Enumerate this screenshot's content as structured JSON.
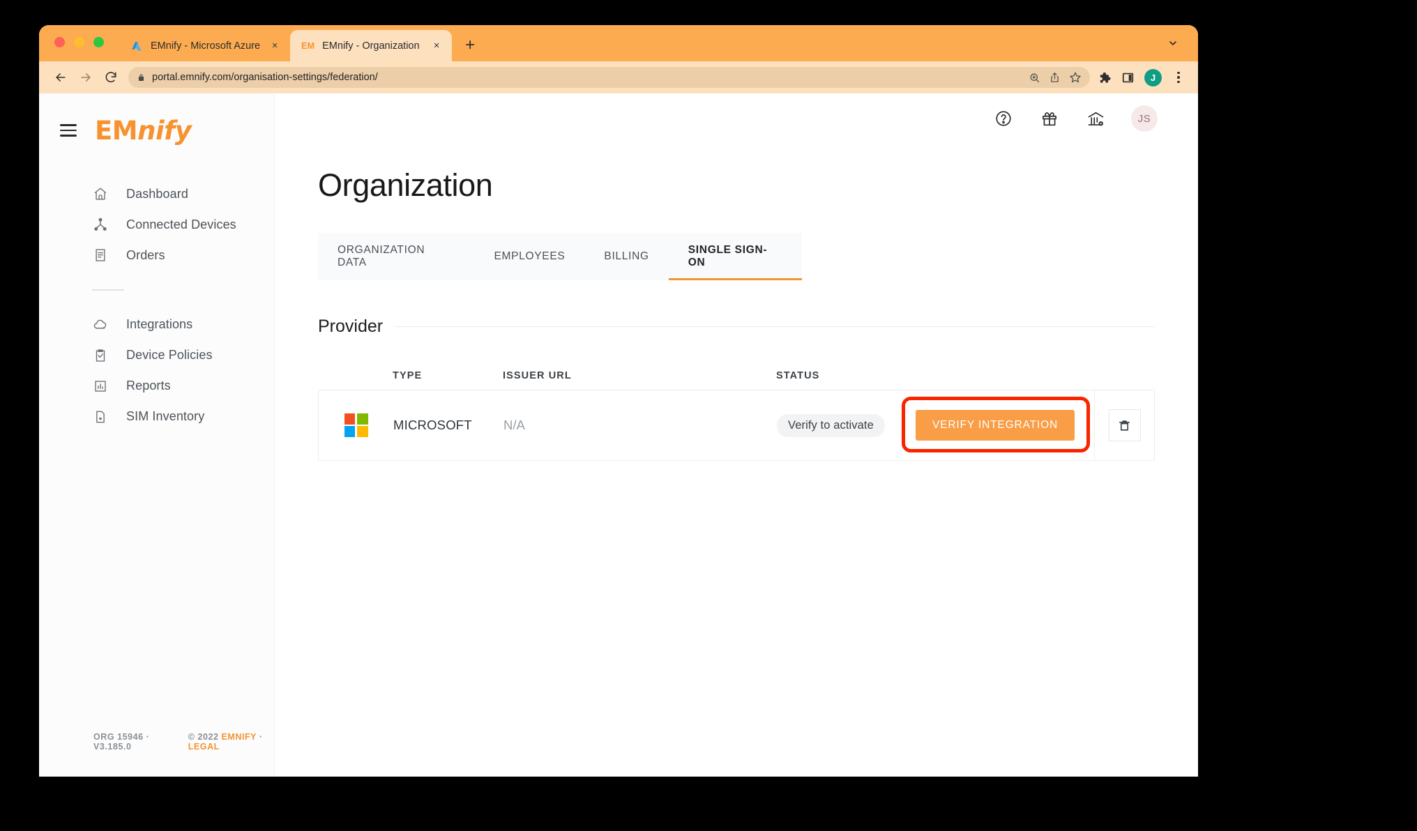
{
  "browser": {
    "tabs": [
      {
        "favicon": "azure-icon",
        "title": "EMnify - Microsoft Azure",
        "active": false,
        "close_label": "×"
      },
      {
        "favicon": "emnify-icon",
        "favicon_text": "EM",
        "title": "EMnify - Organization",
        "active": true,
        "close_label": "×"
      }
    ],
    "new_tab_label": "+",
    "window_controls": [
      "close",
      "minimize",
      "maximize"
    ],
    "nav": {
      "back": "←",
      "forward": "→",
      "reload": "↻"
    },
    "omnibox": {
      "url": "portal.emnify.com/organisation-settings/federation/",
      "lock_icon": "lock-icon",
      "zoom_icon": "zoom-in-icon",
      "share_icon": "share-icon",
      "bookmark_icon": "star-icon"
    },
    "toolbar": {
      "extensions_icon": "puzzle-icon",
      "sidepanel_icon": "side-panel-icon",
      "profile_initial": "J",
      "menu_icon": "kebab-menu-icon"
    },
    "tabstrip_chevron": "chevron-down-icon"
  },
  "sidebar": {
    "menu_icon": "hamburger-icon",
    "brand": {
      "prefix": "EM",
      "suffix": "nify"
    },
    "groups": [
      {
        "items": [
          {
            "icon": "home-icon",
            "label": "Dashboard"
          },
          {
            "icon": "devices-network-icon",
            "label": "Connected Devices"
          },
          {
            "icon": "orders-document-icon",
            "label": "Orders"
          }
        ]
      },
      {
        "items": [
          {
            "icon": "cloud-icon",
            "label": "Integrations"
          },
          {
            "icon": "clipboard-check-icon",
            "label": "Device Policies"
          },
          {
            "icon": "bar-chart-icon",
            "label": "Reports"
          },
          {
            "icon": "sim-card-icon",
            "label": "SIM Inventory"
          }
        ]
      }
    ],
    "footer": {
      "org_version": "ORG 15946 · V3.185.0",
      "copyright_prefix": "© 2022 ",
      "company": "EMNIFY",
      "separator": " · ",
      "legal": "LEGAL"
    }
  },
  "topbar": {
    "help_icon": "help-circle-icon",
    "gift_icon": "gift-icon",
    "org_settings_icon": "bank-settings-icon",
    "user_initials": "JS"
  },
  "page": {
    "title": "Organization",
    "tabs": [
      {
        "label": "ORGANIZATION DATA",
        "active": false
      },
      {
        "label": "EMPLOYEES",
        "active": false
      },
      {
        "label": "BILLING",
        "active": false
      },
      {
        "label": "SINGLE SIGN-ON",
        "active": true
      }
    ],
    "section_title": "Provider",
    "table": {
      "columns": [
        "TYPE",
        "ISSUER URL",
        "STATUS"
      ],
      "rows": [
        {
          "logo": "microsoft-logo",
          "type": "MICROSOFT",
          "issuer_url": "N/A",
          "status": "Verify to activate",
          "action_label": "VERIFY INTEGRATION",
          "delete_icon": "trash-icon"
        }
      ]
    }
  },
  "colors": {
    "brand_orange": "#f7922f",
    "button_orange": "#f99d46",
    "highlight_red": "#f92400",
    "browser_chrome": "#fdab50",
    "omnibox_bg": "#eccfa8",
    "ms_red": "#f25022",
    "ms_green": "#7fba00",
    "ms_blue": "#00a4ef",
    "ms_yellow": "#ffb900"
  }
}
